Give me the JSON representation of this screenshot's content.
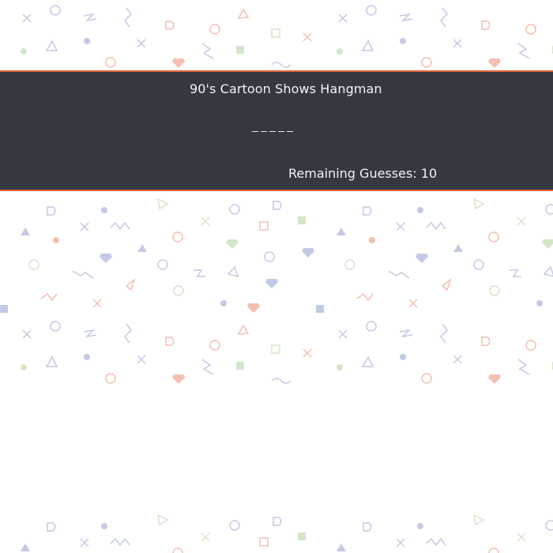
{
  "game": {
    "title": "90's Cartoon Shows Hangman",
    "word_length": 5,
    "remaining_label": "Remaining Guesses:",
    "remaining_count": "10"
  },
  "colors": {
    "banner_bg": "#343841",
    "banner_border": "#e0673e",
    "pattern_red": "#f3bfb3",
    "pattern_blue": "#c4c9e4",
    "pattern_green": "#d4e5c9"
  },
  "background": {
    "pattern": "pastel memphis shapes (circles, triangles, squiggles, crosses, gems, squares)"
  }
}
